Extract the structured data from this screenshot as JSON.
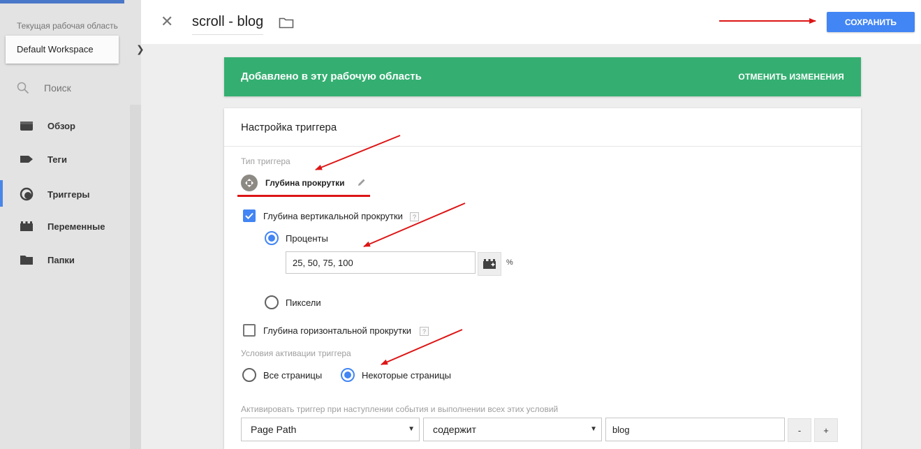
{
  "sidebar": {
    "workspace_label": "Текущая рабочая область",
    "workspace_name": "Default Workspace",
    "search_label": "Поиск",
    "items": [
      {
        "label": "Обзор",
        "icon": "overview-icon"
      },
      {
        "label": "Теги",
        "icon": "tag-icon"
      },
      {
        "label": "Триггеры",
        "icon": "trigger-icon",
        "active": true
      },
      {
        "label": "Переменные",
        "icon": "variables-icon"
      },
      {
        "label": "Папки",
        "icon": "folder-icon"
      }
    ]
  },
  "header": {
    "title": "scroll - blog",
    "save_label": "СОХРАНИТЬ"
  },
  "banner": {
    "text": "Добавлено в эту рабочую область",
    "action": "ОТМЕНИТЬ ИЗМЕНЕНИЯ"
  },
  "card": {
    "title": "Настройка триггера",
    "trigger_type_label": "Тип триггера",
    "trigger_type_name": "Глубина прокрутки",
    "vertical_label": "Глубина вертикальной прокрутки",
    "vertical_checked": true,
    "percent_label": "Проценты",
    "percent_value": "25, 50, 75, 100",
    "percent_unit": "%",
    "pixels_label": "Пиксели",
    "horizontal_label": "Глубина горизонтальной прокрутки",
    "horizontal_checked": false,
    "help_mark": "?",
    "activation_label": "Условия активации триггера",
    "all_pages_label": "Все страницы",
    "some_pages_label": "Некоторые страницы",
    "condition_label": "Активировать триггер при наступлении события и выполнении всех этих условий",
    "condition": {
      "variable": "Page Path",
      "operator": "содержит",
      "value": "blog"
    },
    "minus_label": "-",
    "plus_label": "+"
  },
  "colors": {
    "accent": "#4285f4",
    "banner_green": "#34af71",
    "annotation_red": "#dd1515"
  }
}
